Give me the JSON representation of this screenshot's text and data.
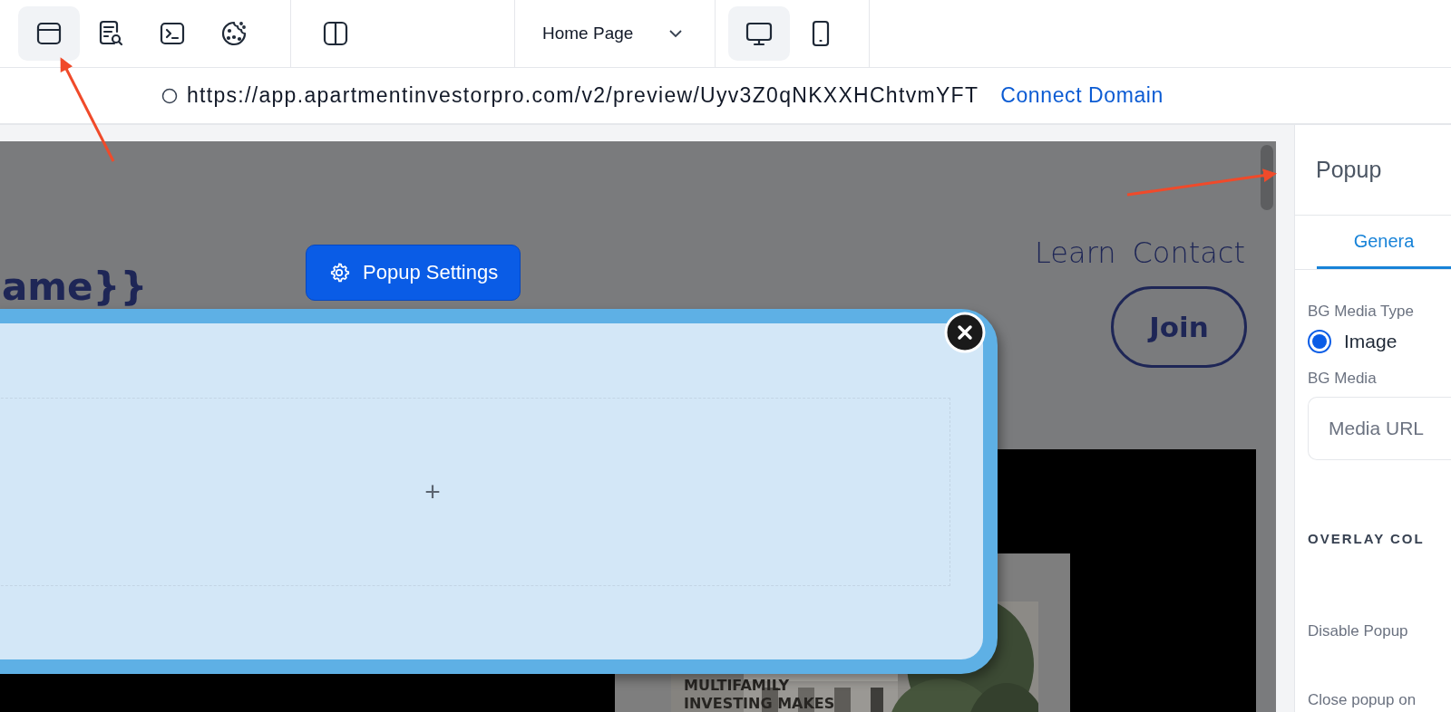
{
  "toolbar": {
    "tool_groups": [
      [
        {
          "kind": "layout",
          "selected": true
        },
        {
          "kind": "seo",
          "selected": false
        },
        {
          "kind": "code",
          "selected": false
        },
        {
          "kind": "cookie",
          "selected": false
        }
      ],
      [
        {
          "kind": "split",
          "selected": false
        }
      ]
    ],
    "page_select": {
      "value": "Home Page"
    },
    "devices": [
      {
        "kind": "desktop",
        "selected": true
      },
      {
        "kind": "tablet",
        "selected": false
      }
    ]
  },
  "address_bar": {
    "url": "https://app.apartmentinvestorpro.com/v2/preview/Uyv3Z0qNKXXHChtvmYFT",
    "link": "Connect Domain"
  },
  "preview": {
    "heading": "ame}}",
    "nav": [
      "Learn",
      "Contact"
    ],
    "join_button": "Join",
    "hero_text": "MULTIFAMILY INVESTING MAKES",
    "popup_settings_button": "Popup Settings",
    "popup": {
      "add_symbol": "+"
    }
  },
  "panel": {
    "title": "Popup",
    "tabs": [
      {
        "label": "Genera",
        "selected": true
      }
    ],
    "fields": [
      {
        "kind": "radio",
        "label": "BG Media Type",
        "options": [
          {
            "label": "Image",
            "selected": true
          }
        ]
      },
      {
        "kind": "input",
        "label": "BG Media",
        "placeholder": "Media URL"
      },
      {
        "kind": "section",
        "label": "OVERLAY COL"
      },
      {
        "kind": "label",
        "label": "Disable Popup"
      },
      {
        "kind": "label",
        "label": "Close popup on"
      }
    ]
  }
}
